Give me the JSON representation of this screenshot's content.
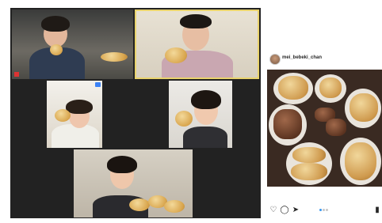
{
  "instagram": {
    "username": "mei_bebeki_chan",
    "icons": {
      "like": "heart-icon",
      "comment": "comment-icon",
      "share": "send-icon",
      "save": "bookmark-icon"
    },
    "carousel_dots": 3,
    "active_dot": 1
  },
  "video_call": {
    "participants": 5,
    "active_speaker_color": "#e9d36c",
    "background": "#222222"
  },
  "colors": {
    "accent_blue": "#3897f0",
    "tile_dark": "#1c1c1c"
  }
}
